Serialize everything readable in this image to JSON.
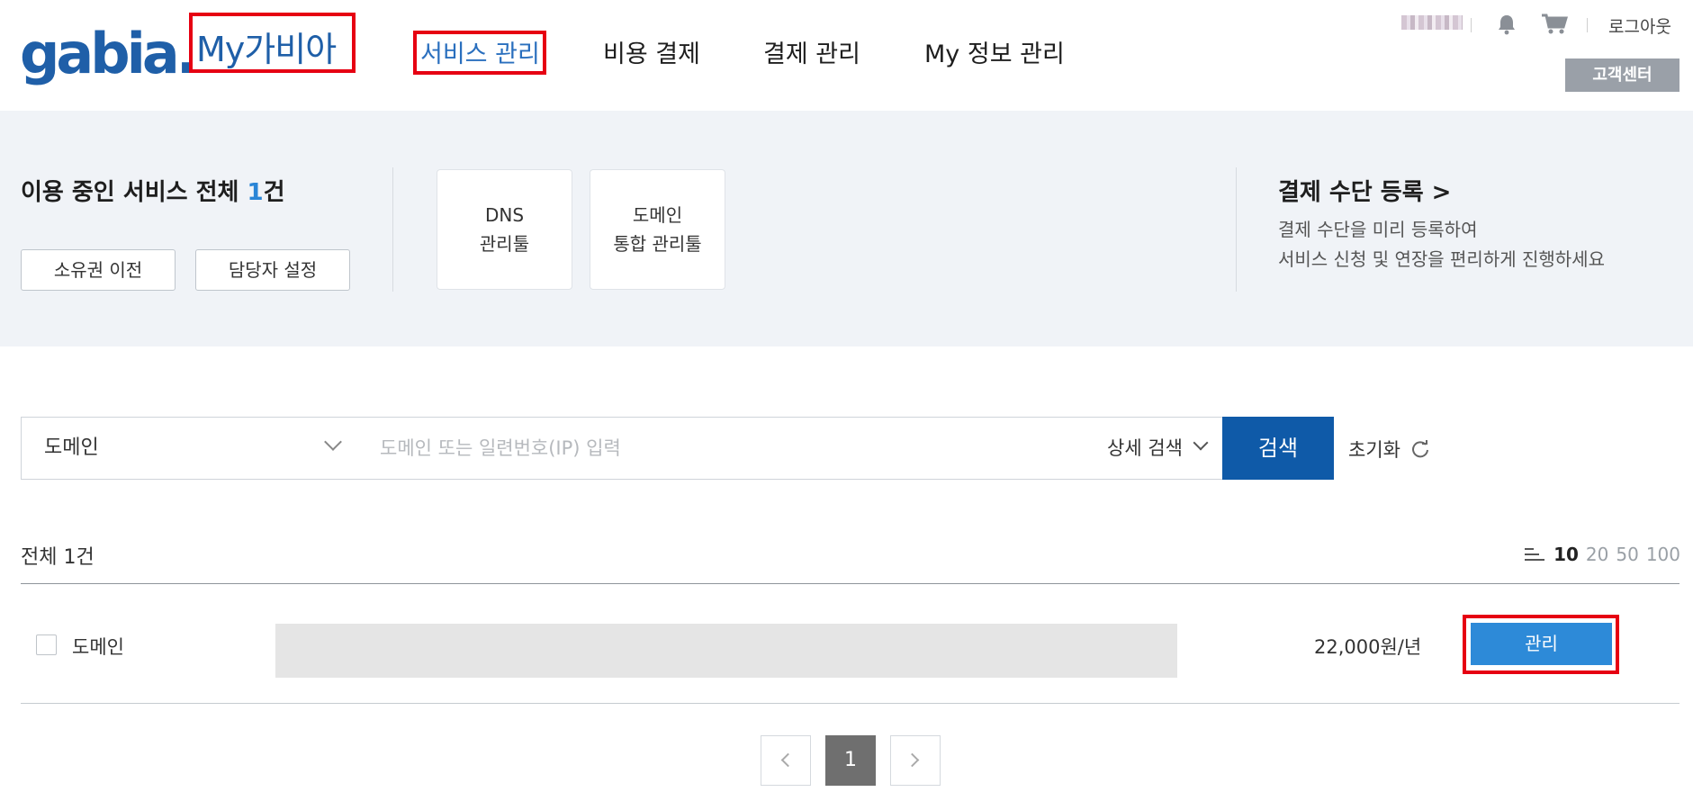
{
  "header": {
    "logo": "gabia.",
    "mygabia": "My가비아",
    "nav": [
      "서비스 관리",
      "비용 결제",
      "결제 관리",
      "My 정보 관리"
    ],
    "logout": "로그아웃",
    "customer_center": "고객센터",
    "icons": [
      "bell-icon",
      "cart-icon"
    ]
  },
  "summary": {
    "title_prefix": "이용 중인 서비스 전체 ",
    "count": "1",
    "title_suffix": "건",
    "buttons": [
      "소유권 이전",
      "담당자 설정"
    ],
    "tools": [
      {
        "line1": "DNS",
        "line2": "관리툴"
      },
      {
        "line1": "도메인",
        "line2": "통합 관리툴"
      }
    ],
    "payment": {
      "title": "결제 수단 등록 >",
      "desc1": "결제 수단을 미리 등록하여",
      "desc2": "서비스 신청 및 연장을 편리하게 진행하세요"
    }
  },
  "search": {
    "category": "도메인",
    "placeholder": "도메인 또는 일련번호(IP) 입력",
    "detail": "상세 검색",
    "button": "검색",
    "reset": "초기화"
  },
  "list": {
    "total": "전체 1건",
    "page_sizes": [
      "10",
      "20",
      "50",
      "100"
    ],
    "selected_page_size": "10",
    "rows": [
      {
        "type": "도메인",
        "price": "22,000원/년",
        "action": "관리"
      }
    ]
  },
  "pagination": {
    "current": "1"
  },
  "colors": {
    "brand_blue": "#1f5fa8",
    "search_button": "#0f5aa8",
    "manage_button": "#2d8ad8",
    "highlight_box": "#e60012",
    "band_bg": "#f0f3f7"
  }
}
